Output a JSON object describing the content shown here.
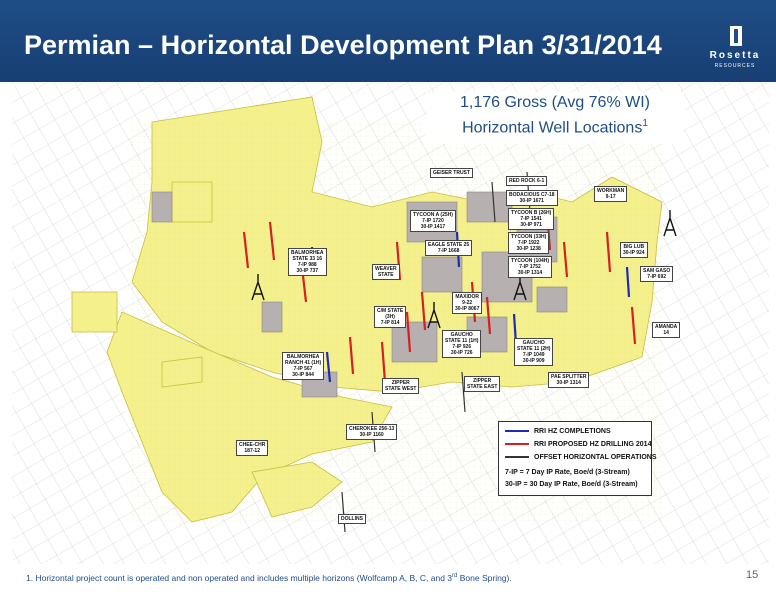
{
  "header": {
    "title": "Permian – Horizontal Development Plan 3/31/2014",
    "logo_name": "Rosetta",
    "logo_sub": "RESOURCES"
  },
  "callout": {
    "line1": "1,176 Gross (Avg 76% WI)",
    "line2": "Horizontal Well Locations",
    "line2_sup": "1"
  },
  "legend": {
    "items": [
      {
        "label": "RRI HZ COMPLETIONS",
        "color": "#1f2bb8"
      },
      {
        "label": "RRI PROPOSED HZ DRILLING 2014",
        "color": "#d42020"
      },
      {
        "label": "OFFSET HORIZONTAL OPERATIONS",
        "color": "#333333"
      }
    ],
    "note1": "7-IP = 7 Day IP Rate, Boe/d (3-Stream)",
    "note2": "30-IP = 30 Day IP Rate, Boe/d (3-Stream)"
  },
  "map_labels": [
    {
      "id": "geiser-trust",
      "text": "GEISER TRUST"
    },
    {
      "id": "red-rock",
      "text": "RED ROCK 6-1"
    },
    {
      "id": "bodacious",
      "text": "BODACIOUS C7-18\n30-IP 1671"
    },
    {
      "id": "workman",
      "text": "WORKMAN\n9-17"
    },
    {
      "id": "tycoon-a",
      "text": "TYCOON A (25H)\n7-IP 1720\n30-IP 1417"
    },
    {
      "id": "tycoon-b",
      "text": "TYCOON B (26H)\n7-IP 1541\n30-IP 971"
    },
    {
      "id": "tycoon-c",
      "text": "TYCOON (33H)\n7-IP 1922\n30-IP 1238"
    },
    {
      "id": "eagle-state",
      "text": "EAGLE STATE 25\n7-IP 1668"
    },
    {
      "id": "tycoon-d",
      "text": "TYCOON (104H)\n7-IP 1752\n30-IP 1314"
    },
    {
      "id": "big-lub",
      "text": "BIG LUB\n30-IP 924"
    },
    {
      "id": "balmorhea-state",
      "text": "BALMORHEA\nSTATE 33 16\n7-IP 988\n30-IP 737"
    },
    {
      "id": "weaver-state",
      "text": "WEAVER\nSTATE"
    },
    {
      "id": "sam-gaso",
      "text": "SAM GASO\n7-IP 692"
    },
    {
      "id": "maxidor",
      "text": "MAXIDOR\n9-22\n30-IP 8067"
    },
    {
      "id": "cm-state",
      "text": "C/M STATE\n(3H)\n7-IP 814"
    },
    {
      "id": "amanda",
      "text": "AMANDA\n14"
    },
    {
      "id": "gaucho-1",
      "text": "GAUCHO\nSTATE 11 (1H)\n7-IP 926\n30-IP 726"
    },
    {
      "id": "gaucho-2",
      "text": "GAUCHO\nSTATE 11 (2H)\n7-IP 1049\n30-IP 909"
    },
    {
      "id": "balmorhea-ranch",
      "text": "BALMORHEA\nRANCH 41 (1H)\n7-IP 567\n30-IP 844"
    },
    {
      "id": "zipper-west",
      "text": "ZIPPER\nSTATE WEST"
    },
    {
      "id": "zipper-east",
      "text": "ZIPPER\nSTATE EAST"
    },
    {
      "id": "pae-splitter",
      "text": "PAE SPLITTER\n30-IP 1314"
    },
    {
      "id": "cherokee",
      "text": "CHEROKEE 256-13\n30-IP 1160"
    },
    {
      "id": "chee-chr",
      "text": "CHEE-CHR\n187-12"
    },
    {
      "id": "dollins",
      "text": "DOLLINS"
    }
  ],
  "footnote": {
    "text_before": "1.  Horizontal project count is operated and non operated and includes multiple horizons (Wolfcamp A, B, C, and 3",
    "sup": "rd",
    "text_after": " Bone Spring)."
  },
  "page_number": "15",
  "colors": {
    "acreage": "#f4f08c",
    "acreage_outline": "#c8bf3a",
    "offset": "#b7b0b0",
    "grid": "#bdbdbd",
    "header": "#1f4d86"
  },
  "icons": [
    "rig-icon"
  ]
}
